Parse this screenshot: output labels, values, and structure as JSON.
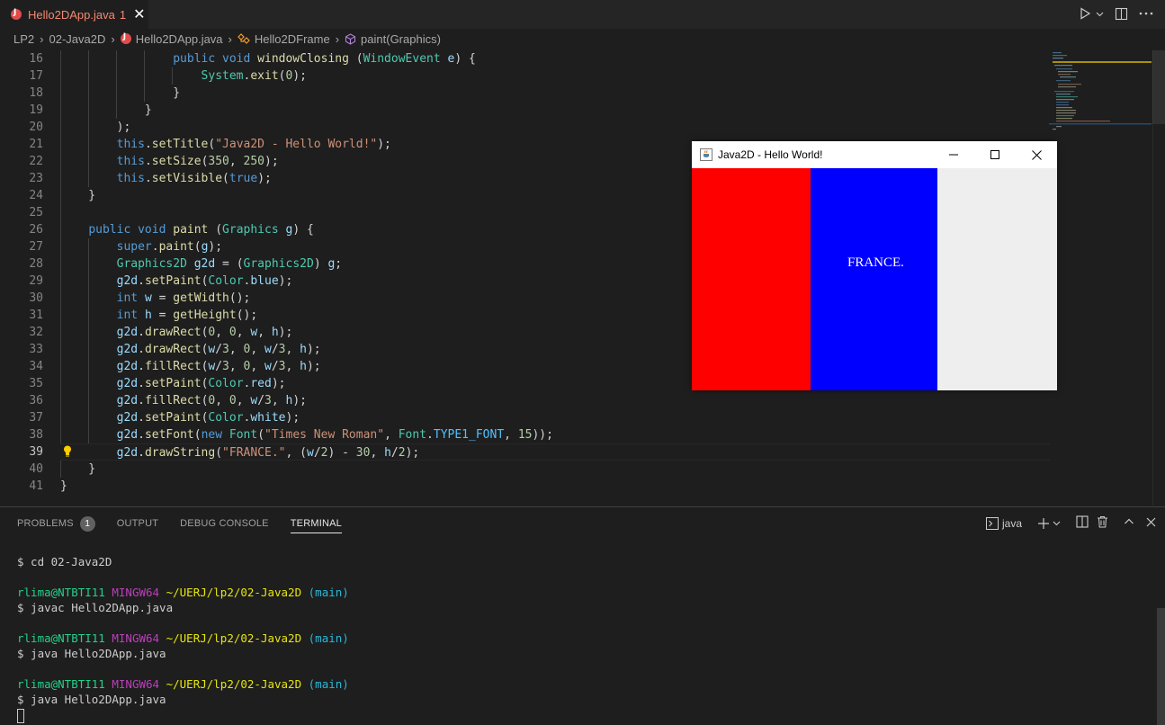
{
  "tab": {
    "filename": "Hello2DApp.java",
    "problem_count": "1",
    "close_glyph": "✕"
  },
  "breadcrumb": {
    "items": [
      "LP2",
      "02-Java2D",
      "Hello2DApp.java",
      "Hello2DFrame",
      "paint(Graphics)"
    ],
    "separator": "›"
  },
  "editor": {
    "line_numbers": [
      "16",
      "17",
      "18",
      "19",
      "20",
      "21",
      "22",
      "23",
      "24",
      "25",
      "26",
      "27",
      "28",
      "29",
      "30",
      "31",
      "32",
      "33",
      "34",
      "35",
      "36",
      "37",
      "38",
      "39",
      "40",
      "41"
    ],
    "active_line": "39"
  },
  "java_window": {
    "title": "Java2D - Hello World!",
    "flag_text": "FRANCE.",
    "colors": {
      "red": "#ff0000",
      "blue": "#0000ff",
      "white": "#eeeeee"
    }
  },
  "panel": {
    "tabs": [
      "PROBLEMS",
      "OUTPUT",
      "DEBUG CONSOLE",
      "TERMINAL"
    ],
    "problems_badge": "1",
    "active_tab": "TERMINAL",
    "terminal_name": "java"
  },
  "terminal": {
    "first_command": "$ cd 02-Java2D",
    "prompt": {
      "user": "rlima@NTBTI11",
      "host": "MINGW64",
      "path": "~/UERJ/lp2/02-Java2D",
      "branch": "(main)"
    },
    "commands": [
      "$ javac Hello2DApp.java",
      "$ java Hello2DApp.java",
      "$ java Hello2DApp.java"
    ]
  },
  "colors": {
    "editor_bg": "#1e1e1e",
    "keyword": "#569cd6",
    "type": "#4ec9b0",
    "function": "#dcdcaa",
    "string": "#ce9178",
    "number": "#b5cea8",
    "variable": "#9cdcfe",
    "error": "#f48771"
  },
  "icons": [
    "java-file-icon",
    "run-icon",
    "split-editor-icon",
    "more-icon",
    "class-icon",
    "method-icon",
    "lightbulb-icon",
    "terminal-icon",
    "plus-icon",
    "trash-icon",
    "maximize-icon",
    "close-icon"
  ]
}
